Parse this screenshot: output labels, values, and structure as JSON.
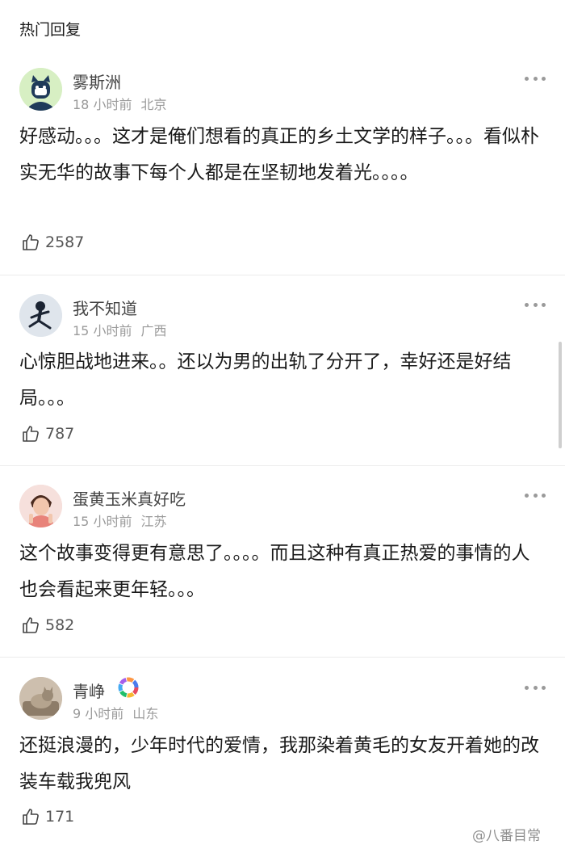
{
  "section_title": "热门回复",
  "comments": [
    {
      "username": "雾斯洲",
      "time": "18 小时前",
      "location": "北京",
      "text": "好感动。。。这才是俺们想看的真正的乡土文学的样子。。。看似朴实无华的故事下每个人都是在坚韧地发着光。。。。",
      "likes": "2587",
      "avatar_icon": "cartoon-cat-avatar-icon"
    },
    {
      "username": "我不知道",
      "time": "15 小时前",
      "location": "广西",
      "text": "心惊胆战地进来。。还以为男的出轨了分开了，幸好还是好结局。。。",
      "likes": "787",
      "avatar_icon": "dancing-figure-avatar-icon"
    },
    {
      "username": "蛋黄玉米真好吃",
      "time": "15 小时前",
      "location": "江苏",
      "text": "这个故事变得更有意思了。。。。而且这种有真正热爱的事情的人也会看起来更年轻。。。",
      "likes": "582",
      "avatar_icon": "person-photo-avatar-icon"
    },
    {
      "username": "青峥",
      "time": "9 小时前",
      "location": "山东",
      "text": "还挺浪漫的，少年时代的爱情，我那染着黄毛的女友开着她的改装车载我兜风",
      "likes": "171",
      "avatar_icon": "cat-photo-avatar-icon",
      "badge_icon": "rainbow-ring-badge-icon"
    }
  ],
  "watermark": "@八番目常",
  "colors": {
    "text": "#1a1a1a",
    "secondary": "#9a9a9a",
    "divider": "#ececec"
  }
}
